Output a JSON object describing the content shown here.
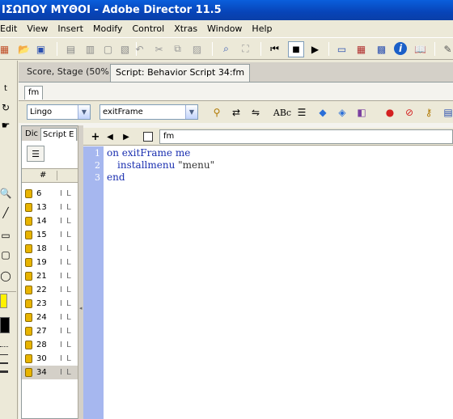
{
  "window": {
    "title": "ΙΣΩΠΟΥ ΜΥΘΟΙ - Adobe Director 11.5"
  },
  "menu": [
    "Edit",
    "View",
    "Insert",
    "Modify",
    "Control",
    "Xtras",
    "Window",
    "Help"
  ],
  "tabs": [
    "Score, Stage (50%)",
    "Script: Behavior Script 34:fm"
  ],
  "subtab": "fm",
  "script_toolbar": {
    "language": "Lingo",
    "handler": "exitFrame"
  },
  "cast_panel": {
    "tabs": [
      "Dic",
      "Script E"
    ],
    "column_header": "#",
    "rows": [
      {
        "num": "6",
        "dots": "I L"
      },
      {
        "num": "13",
        "dots": "I L"
      },
      {
        "num": "14",
        "dots": "I L"
      },
      {
        "num": "15",
        "dots": "I L"
      },
      {
        "num": "18",
        "dots": "I L"
      },
      {
        "num": "19",
        "dots": "I L"
      },
      {
        "num": "21",
        "dots": "I L"
      },
      {
        "num": "22",
        "dots": "I L"
      },
      {
        "num": "23",
        "dots": "I L"
      },
      {
        "num": "24",
        "dots": "I L"
      },
      {
        "num": "27",
        "dots": "I L"
      },
      {
        "num": "28",
        "dots": "I L"
      },
      {
        "num": "30",
        "dots": "I L"
      },
      {
        "num": "34",
        "dots": "I L"
      }
    ],
    "selected": "34"
  },
  "nav": {
    "member_name": "fm"
  },
  "code": {
    "line_numbers": [
      "1",
      "2",
      "3"
    ],
    "line1_kw": "on",
    "line1_handler": "exitFrame",
    "line1_me": "me",
    "line2_cmd": "installmenu",
    "line2_arg": "\"menu\"",
    "line3_kw": "end"
  },
  "colors": {
    "gutter": "#a6b7ef",
    "keyword": "#1a2fb0",
    "titlebar": "#0a5fdc"
  }
}
